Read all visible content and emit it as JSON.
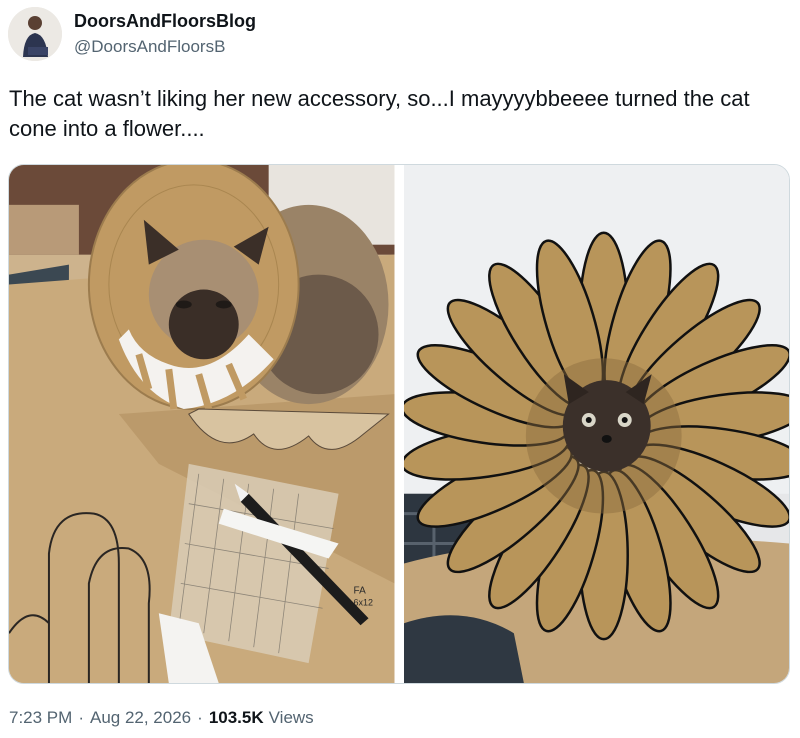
{
  "author": {
    "display_name": "DoorsAndFloorsBlog",
    "handle": "@DoorsAndFloorsB"
  },
  "tweet": {
    "text": "The cat wasn’t liking her new accessory, so...I mayyyybbeeee turned the cat cone into a flower...."
  },
  "media": {
    "ruler_brand": "FA",
    "ruler_size": "6x12"
  },
  "meta": {
    "time": "7:23 PM",
    "separator": "·",
    "date": "Aug 22, 2026",
    "views_count": "103.5K",
    "views_label": "Views"
  },
  "colors": {
    "text": "#0f1419",
    "secondary": "#536471",
    "kraft_paper": "#c9aa7c",
    "petal": "#b8955a"
  }
}
